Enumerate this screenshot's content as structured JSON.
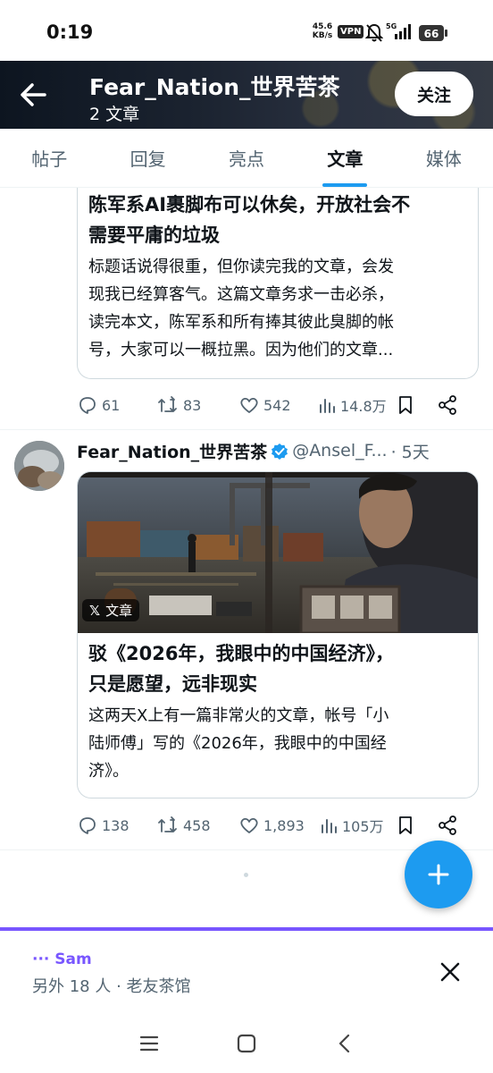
{
  "status_bar": {
    "time": "0:19",
    "speed_value": "45.6",
    "speed_unit": "KB/s",
    "vpn": "VPN",
    "network": "5G",
    "battery": "66"
  },
  "header": {
    "title": "Fear_Nation_世界苦茶",
    "subtitle": "2 文章",
    "follow_label": "关注"
  },
  "tabs": [
    {
      "label": "帖子",
      "active": false
    },
    {
      "label": "回复",
      "active": false
    },
    {
      "label": "亮点",
      "active": false
    },
    {
      "label": "文章",
      "active": true
    },
    {
      "label": "媒体",
      "active": false
    }
  ],
  "post1": {
    "title_line1": "陈军系AI裹脚布可以休矣，开放社会不",
    "title_line2": "需要平庸的垃圾",
    "body_line1": "标题话说得很重，但你读完我的文章，会发",
    "body_line2": "现我已经算客气。这篇文章务求一击必杀，",
    "body_line3": "读完本文，陈军系和所有捧其彼此臭脚的帐",
    "body_line4": "号，大家可以一概拉黑。因为他们的文章...",
    "replies": "61",
    "reposts": "83",
    "likes": "542",
    "views": "14.8万"
  },
  "post2": {
    "name": "Fear_Nation_世界苦茶",
    "handle": "@Ansel_F...",
    "time": "· 5天",
    "badge": "文章",
    "title_line1": "驳《2026年，我眼中的中国经济》，",
    "title_line2": "只是愿望，远非现实",
    "body_line1": "这两天X上有一篇非常火的文章，帐号「小",
    "body_line2": "陆师傅」写的《2026年，我眼中的中国经",
    "body_line3": "济》。",
    "replies": "138",
    "reposts": "458",
    "likes": "1,893",
    "views": "105万"
  },
  "banner": {
    "user": "··· Sam",
    "info": "另外 18 人 · 老友茶馆"
  },
  "colors": {
    "accent": "#1d9bf0",
    "community": "#7856ff",
    "muted": "#536471"
  }
}
